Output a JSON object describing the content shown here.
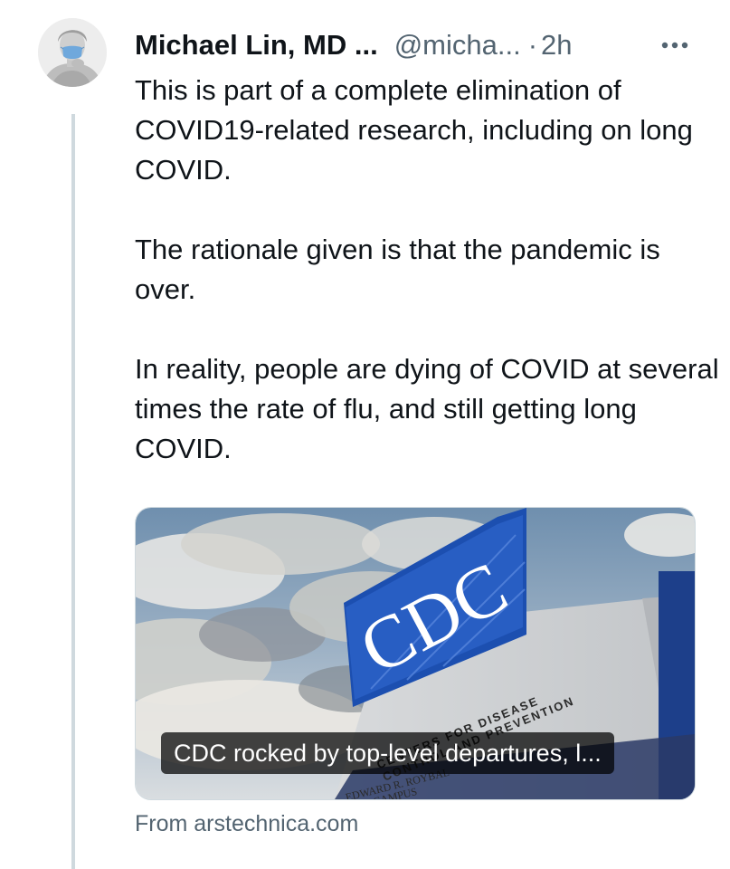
{
  "tweet": {
    "author_name": "Michael Lin, MD ...",
    "handle": "@micha...",
    "separator": "·",
    "time": "2h",
    "paragraphs": [
      "This is part of a complete elimination of COVID19-related research, including on long COVID.",
      "The rationale given is that the pandemic is over.",
      "In reality, people are dying of COVID at several times the rate of flu, and still getting long COVID."
    ]
  },
  "card": {
    "title": "CDC rocked by top-level departures, l...",
    "source": "From arstechnica.com",
    "sign_text": "CDC",
    "sign_lines": [
      "CENTERS FOR DISEASE",
      "CONTROL AND PREVENTION"
    ],
    "plaque_text": [
      "EDWARD R. ROYBAL",
      "CAMPUS"
    ]
  },
  "icons": {
    "avatar": "statue-with-mask-avatar",
    "more": "more-options-icon"
  },
  "colors": {
    "text": "#0f1419",
    "secondary": "#536471",
    "thread_line": "#cfd9de",
    "cdc_blue": "#1c4fb0"
  }
}
